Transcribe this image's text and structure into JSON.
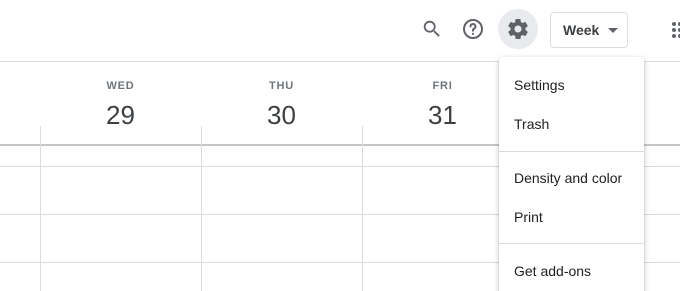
{
  "header": {
    "view_select": {
      "label": "Week"
    },
    "search_icon": "search-icon",
    "help_icon": "help-icon",
    "settings_icon": "gear-icon",
    "apps_icon": "apps-grid-icon"
  },
  "days": [
    {
      "dow": "WED",
      "date": "29"
    },
    {
      "dow": "THU",
      "date": "30"
    },
    {
      "dow": "FRI",
      "date": "31"
    }
  ],
  "settings_menu": {
    "items": [
      {
        "label": "Settings"
      },
      {
        "label": "Trash"
      },
      {
        "label": "Density and color"
      },
      {
        "label": "Print"
      },
      {
        "label": "Get add-ons"
      }
    ]
  },
  "colors": {
    "text": "#3c4043",
    "muted": "#70757a",
    "grid": "#dadce0",
    "active_bg": "#e8eaed"
  }
}
